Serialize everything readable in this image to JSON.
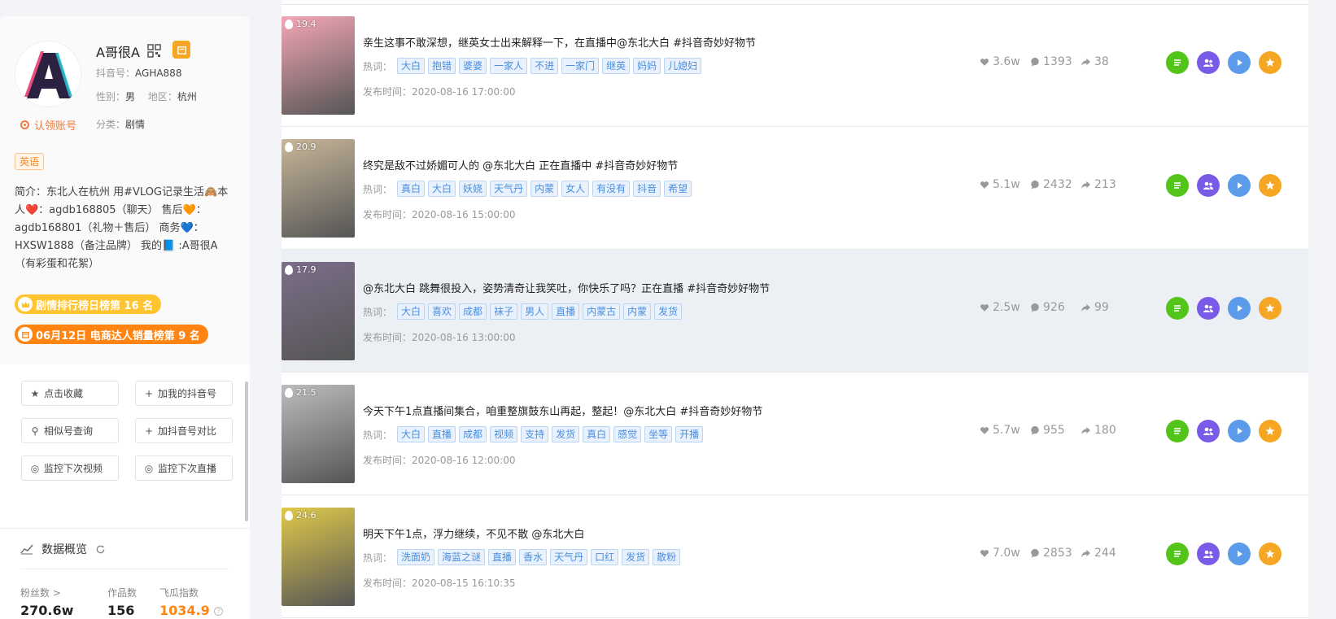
{
  "profile": {
    "name": "A哥很A",
    "douyin_label": "抖音号：",
    "douyin_id": "AGHA888",
    "gender_label": "性别：",
    "gender": "男",
    "region_label": "地区：",
    "region": "杭州",
    "claim": "认领账号",
    "category_label": "分类：",
    "category": "剧情",
    "lang_tag": "英语",
    "bio": "简介：东北人在杭州 用#VLOG记录生活🙈本人❤️：agdb168805（聊天） 售后🧡：agdb168801（礼物＋售后） 商务💙：HXSW1888（备注品牌） 我的📘 :A哥很A（有彩蛋和花絮）",
    "rank1": "剧情排行榜日榜第 16 名",
    "rank2": "06月12日 电商达人销量榜第 9 名"
  },
  "actions": [
    {
      "icon": "star-icon",
      "glyph": "★",
      "label": "点击收藏"
    },
    {
      "icon": "plus-icon",
      "glyph": "+",
      "label": "加我的抖音号"
    },
    {
      "icon": "search-icon",
      "glyph": "⚲",
      "label": "相似号查询"
    },
    {
      "icon": "plus-icon",
      "glyph": "+",
      "label": "加抖音号对比"
    },
    {
      "icon": "eye-icon",
      "glyph": "◎",
      "label": "监控下次视频"
    },
    {
      "icon": "eye-icon",
      "glyph": "◎",
      "label": "监控下次直播"
    }
  ],
  "overview": {
    "title": "数据概览",
    "fans_label": "粉丝数 >",
    "fans": "270.6w",
    "works_label": "作品数",
    "works": "156",
    "index_label": "飞瓜指数",
    "index": "1034.9"
  },
  "keyword_label": "热词：",
  "publish_label": "发布时间：",
  "videos": [
    {
      "heat": "19.4",
      "title": "亲生这事不敢深想，继英女士出来解释一下，在直播中@东北大白 #抖音奇妙好物节",
      "tags": [
        "大白",
        "抱错",
        "婆婆",
        "一家人",
        "不进",
        "一家门",
        "继英",
        "妈妈",
        "儿媳妇"
      ],
      "time": "2020-08-16 17:00:00",
      "likes": "3.6w",
      "comments": "1393",
      "shares": "38",
      "thumb_bg": "#f4a7b5"
    },
    {
      "heat": "20.9",
      "title": "终究是敌不过娇媚可人的 @东北大白 正在直播中 #抖音奇妙好物节",
      "tags": [
        "真白",
        "大白",
        "妖娆",
        "天气丹",
        "内蒙",
        "女人",
        "有没有",
        "抖音",
        "希望"
      ],
      "time": "2020-08-16 15:00:00",
      "likes": "5.1w",
      "comments": "2432",
      "shares": "213",
      "thumb_bg": "#c8b79a"
    },
    {
      "heat": "17.9",
      "title": "@东北大白 跳舞很投入，姿势清奇让我笑吐，你快乐了吗？正在直播 #抖音奇妙好物节",
      "tags": [
        "大白",
        "喜欢",
        "成都",
        "袜子",
        "男人",
        "直播",
        "内蒙古",
        "内蒙",
        "发货"
      ],
      "time": "2020-08-16 13:00:00",
      "likes": "2.5w",
      "comments": "926",
      "shares": "99",
      "thumb_bg": "#7c6e8a"
    },
    {
      "heat": "21.5",
      "title": "今天下午1点直播间集合，咱重整旗鼓东山再起，整起！@东北大白 #抖音奇妙好物节",
      "tags": [
        "大白",
        "直播",
        "成都",
        "视频",
        "支持",
        "发货",
        "真白",
        "感觉",
        "坐等",
        "开播"
      ],
      "time": "2020-08-16 12:00:00",
      "likes": "5.7w",
      "comments": "955",
      "shares": "180",
      "thumb_bg": "#bdbdbd"
    },
    {
      "heat": "24.6",
      "title": "明天下午1点，浮力继续，不见不散 @东北大白",
      "tags": [
        "洗面奶",
        "海蓝之谜",
        "直播",
        "香水",
        "天气丹",
        "口红",
        "发货",
        "散粉"
      ],
      "time": "2020-08-15 16:10:35",
      "likes": "7.0w",
      "comments": "2853",
      "shares": "244",
      "thumb_bg": "#e0c94a"
    }
  ]
}
